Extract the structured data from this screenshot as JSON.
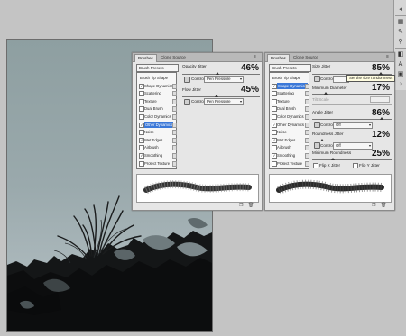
{
  "toolstrip": {
    "icons": [
      "arrow-icon",
      "marquee-icon",
      "brush-tool-icon",
      "stamp-icon",
      "history-icon",
      "type-icon",
      "layers-icon",
      "adjust-icon",
      "paths-icon"
    ]
  },
  "panel1": {
    "tabs": [
      "Brushes",
      "Clone Source"
    ],
    "presets_label": "Brush Presets",
    "options": [
      {
        "label": "Brush Tip Shape",
        "checked": null,
        "highlight": false
      },
      {
        "label": "Shape Dynamics",
        "checked": true,
        "highlight": false
      },
      {
        "label": "Scattering",
        "checked": false,
        "highlight": false
      },
      {
        "label": "Texture",
        "checked": false,
        "highlight": false
      },
      {
        "label": "Dual Brush",
        "checked": false,
        "highlight": false
      },
      {
        "label": "Color Dynamics",
        "checked": false,
        "highlight": false
      },
      {
        "label": "Other Dynamics",
        "checked": true,
        "highlight": true
      },
      {
        "label": "Noise",
        "checked": false,
        "highlight": false
      },
      {
        "label": "Wet Edges",
        "checked": true,
        "highlight": false
      },
      {
        "label": "Airbrush",
        "checked": false,
        "highlight": false
      },
      {
        "label": "Smoothing",
        "checked": true,
        "highlight": false
      },
      {
        "label": "Protect Texture",
        "checked": false,
        "highlight": false
      }
    ],
    "opacity_jitter_label": "Opacity Jitter",
    "opacity_jitter_value": "46%",
    "opacity_control_label": "Control:",
    "opacity_control_value": "Pen Pressure",
    "flow_jitter_label": "Flow Jitter",
    "flow_jitter_value": "45%",
    "flow_control_label": "Control:",
    "flow_control_value": "Pen Pressure"
  },
  "panel2": {
    "tabs": [
      "Brushes",
      "Clone Source"
    ],
    "presets_label": "Brush Presets",
    "options": [
      {
        "label": "Brush Tip Shape",
        "checked": null,
        "highlight": false
      },
      {
        "label": "Shape Dynamics",
        "checked": true,
        "highlight": true
      },
      {
        "label": "Scattering",
        "checked": false,
        "highlight": false
      },
      {
        "label": "Texture",
        "checked": false,
        "highlight": false
      },
      {
        "label": "Dual Brush",
        "checked": false,
        "highlight": false
      },
      {
        "label": "Color Dynamics",
        "checked": false,
        "highlight": false
      },
      {
        "label": "Other Dynamics",
        "checked": true,
        "highlight": false
      },
      {
        "label": "Noise",
        "checked": false,
        "highlight": false
      },
      {
        "label": "Wet Edges",
        "checked": true,
        "highlight": false
      },
      {
        "label": "Airbrush",
        "checked": false,
        "highlight": false
      },
      {
        "label": "Smoothing",
        "checked": true,
        "highlight": false
      },
      {
        "label": "Protect Texture",
        "checked": false,
        "highlight": false
      }
    ],
    "size_jitter_label": "Size Jitter",
    "size_jitter_value": "85%",
    "size_control_label": "Control:",
    "tooltip": "Set the size randomness",
    "min_diameter_label": "Minimum Diameter",
    "min_diameter_value": "17%",
    "tilt_scale_label": "Tilt Scale",
    "angle_jitter_label": "Angle Jitter",
    "angle_jitter_value": "86%",
    "angle_control_label": "Control:",
    "angle_control_value": "Off",
    "roundness_jitter_label": "Roundness Jitter",
    "roundness_jitter_value": "12%",
    "roundness_control_label": "Control:",
    "roundness_control_value": "Off",
    "min_roundness_label": "Minimum Roundness",
    "min_roundness_value": "25%",
    "flip_x_label": "Flip X Jitter",
    "flip_y_label": "Flip Y Jitter"
  },
  "colors": {
    "highlight": "#3b78d8",
    "panel_bg": "#e6e6e6",
    "sky_top": "#8e9fa1",
    "ink": "#141617"
  }
}
